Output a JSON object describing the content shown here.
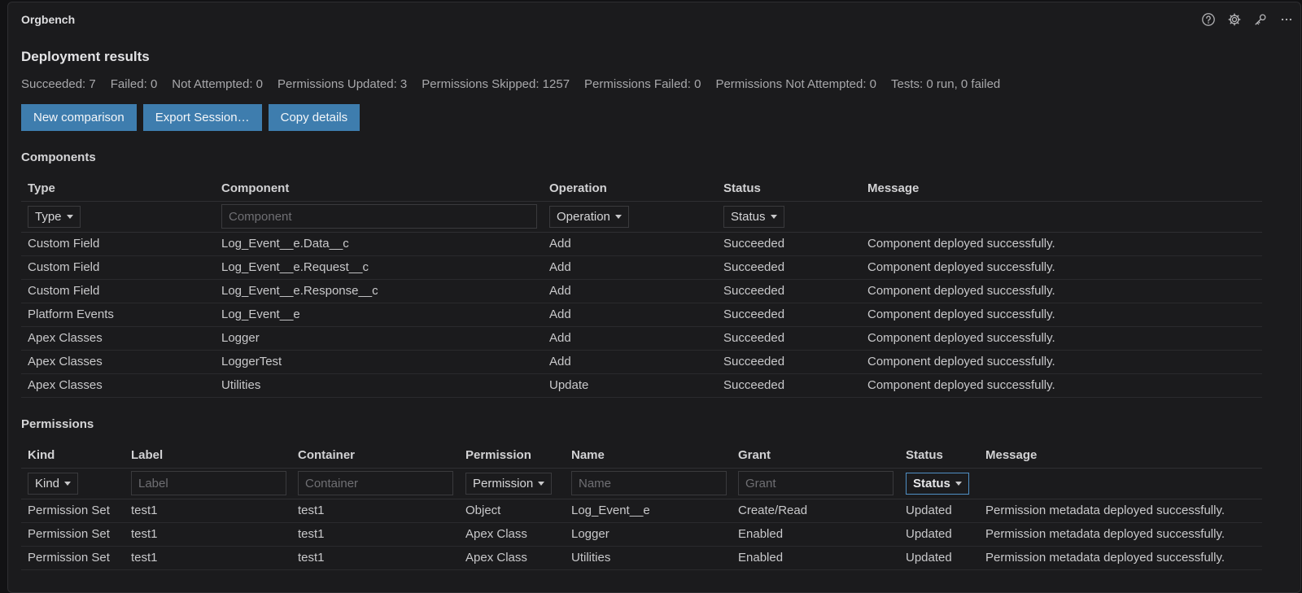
{
  "app": {
    "title": "Orgbench"
  },
  "page": {
    "title": "Deployment results"
  },
  "summary": [
    "Succeeded: 7",
    "Failed: 0",
    "Not Attempted: 0",
    "Permissions Updated: 3",
    "Permissions Skipped: 1257",
    "Permissions Failed: 0",
    "Permissions Not Attempted: 0",
    "Tests: 0 run, 0 failed"
  ],
  "buttons": {
    "new_comparison": "New comparison",
    "export_session": "Export Session…",
    "copy_details": "Copy details"
  },
  "components": {
    "title": "Components",
    "headers": [
      "Type",
      "Component",
      "Operation",
      "Status",
      "Message"
    ],
    "filters": {
      "type": "Type",
      "component_placeholder": "Component",
      "operation": "Operation",
      "status": "Status"
    },
    "rows": [
      [
        "Custom Field",
        "Log_Event__e.Data__c",
        "Add",
        "Succeeded",
        "Component deployed successfully."
      ],
      [
        "Custom Field",
        "Log_Event__e.Request__c",
        "Add",
        "Succeeded",
        "Component deployed successfully."
      ],
      [
        "Custom Field",
        "Log_Event__e.Response__c",
        "Add",
        "Succeeded",
        "Component deployed successfully."
      ],
      [
        "Platform Events",
        "Log_Event__e",
        "Add",
        "Succeeded",
        "Component deployed successfully."
      ],
      [
        "Apex Classes",
        "Logger",
        "Add",
        "Succeeded",
        "Component deployed successfully."
      ],
      [
        "Apex Classes",
        "LoggerTest",
        "Add",
        "Succeeded",
        "Component deployed successfully."
      ],
      [
        "Apex Classes",
        "Utilities",
        "Update",
        "Succeeded",
        "Component deployed successfully."
      ]
    ]
  },
  "permissions": {
    "title": "Permissions",
    "headers": [
      "Kind",
      "Label",
      "Container",
      "Permission",
      "Name",
      "Grant",
      "Status",
      "Message"
    ],
    "filters": {
      "kind": "Kind",
      "label_placeholder": "Label",
      "container_placeholder": "Container",
      "permission": "Permission",
      "name_placeholder": "Name",
      "grant_placeholder": "Grant",
      "status": "Status"
    },
    "rows": [
      [
        "Permission Set",
        "test1",
        "test1",
        "Object",
        "Log_Event__e",
        "Create/Read",
        "Updated",
        "Permission metadata deployed successfully."
      ],
      [
        "Permission Set",
        "test1",
        "test1",
        "Apex Class",
        "Logger",
        "Enabled",
        "Updated",
        "Permission metadata deployed successfully."
      ],
      [
        "Permission Set",
        "test1",
        "test1",
        "Apex Class",
        "Utilities",
        "Enabled",
        "Updated",
        "Permission metadata deployed successfully."
      ]
    ]
  },
  "icons": {
    "help": "help-icon",
    "settings": "gear-icon",
    "key": "key-icon",
    "more": "more-icon"
  }
}
